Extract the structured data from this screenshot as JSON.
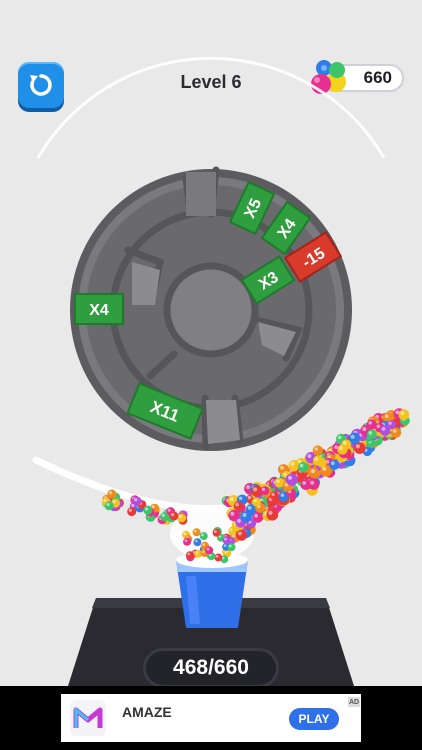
{
  "header": {
    "level_label": "Level 6",
    "ball_total": "660"
  },
  "wheel": {
    "multipliers": [
      "X5",
      "X4",
      "-15",
      "X3",
      "X4",
      "X11"
    ]
  },
  "progress": {
    "label": "468/660",
    "collected": 468,
    "target": 660
  },
  "ad": {
    "app_name": "AMAZE",
    "cta_label": "PLAY",
    "badge": "AD"
  },
  "colors": {
    "multiplier_green": "#2f9e3e",
    "penalty_red": "#d83a2c",
    "wheel_gray": "#6b6b6f",
    "button_blue": "#1f8fe8",
    "cup_blue": "#2f6fe8"
  },
  "icons": {
    "restart": "restart-icon",
    "balls": "colored-balls-icon",
    "ad_logo": "amaze-logo-icon"
  }
}
